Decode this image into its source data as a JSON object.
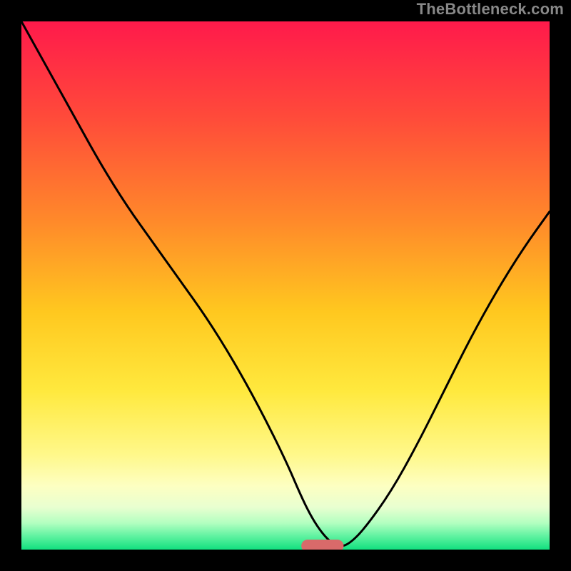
{
  "watermark": "TheBottleneck.com",
  "chart_data": {
    "type": "line",
    "title": "",
    "xlabel": "",
    "ylabel": "",
    "xlim": [
      0,
      100
    ],
    "ylim": [
      0,
      100
    ],
    "grid": false,
    "legend": false,
    "background_gradient": {
      "direction": "vertical",
      "stops": [
        {
          "pos": 0.0,
          "color": "#ff1a4b"
        },
        {
          "pos": 0.18,
          "color": "#ff4a3a"
        },
        {
          "pos": 0.38,
          "color": "#ff8a2a"
        },
        {
          "pos": 0.55,
          "color": "#ffc81f"
        },
        {
          "pos": 0.7,
          "color": "#ffe93e"
        },
        {
          "pos": 0.82,
          "color": "#fff88a"
        },
        {
          "pos": 0.88,
          "color": "#fdffc2"
        },
        {
          "pos": 0.92,
          "color": "#e8ffd0"
        },
        {
          "pos": 0.95,
          "color": "#b2ffc0"
        },
        {
          "pos": 0.975,
          "color": "#5ef2a0"
        },
        {
          "pos": 1.0,
          "color": "#12e07f"
        }
      ]
    },
    "series": [
      {
        "name": "bottleneck-curve",
        "color": "#000000",
        "x": [
          0,
          5,
          10,
          15,
          20,
          25,
          30,
          35,
          40,
          45,
          50,
          53,
          55,
          57,
          59,
          60,
          62,
          65,
          70,
          75,
          80,
          85,
          90,
          95,
          100
        ],
        "y": [
          100,
          91,
          82,
          73,
          65,
          58,
          51,
          44,
          36,
          27,
          17,
          10,
          6,
          3,
          1,
          0.5,
          1,
          4,
          11,
          20,
          30,
          40,
          49,
          57,
          64
        ]
      }
    ],
    "marker": {
      "name": "optimum-marker",
      "shape": "capsule",
      "color": "#d96a6a",
      "x_center": 57,
      "x_width": 8,
      "y": 0.7,
      "height": 2.4
    }
  }
}
